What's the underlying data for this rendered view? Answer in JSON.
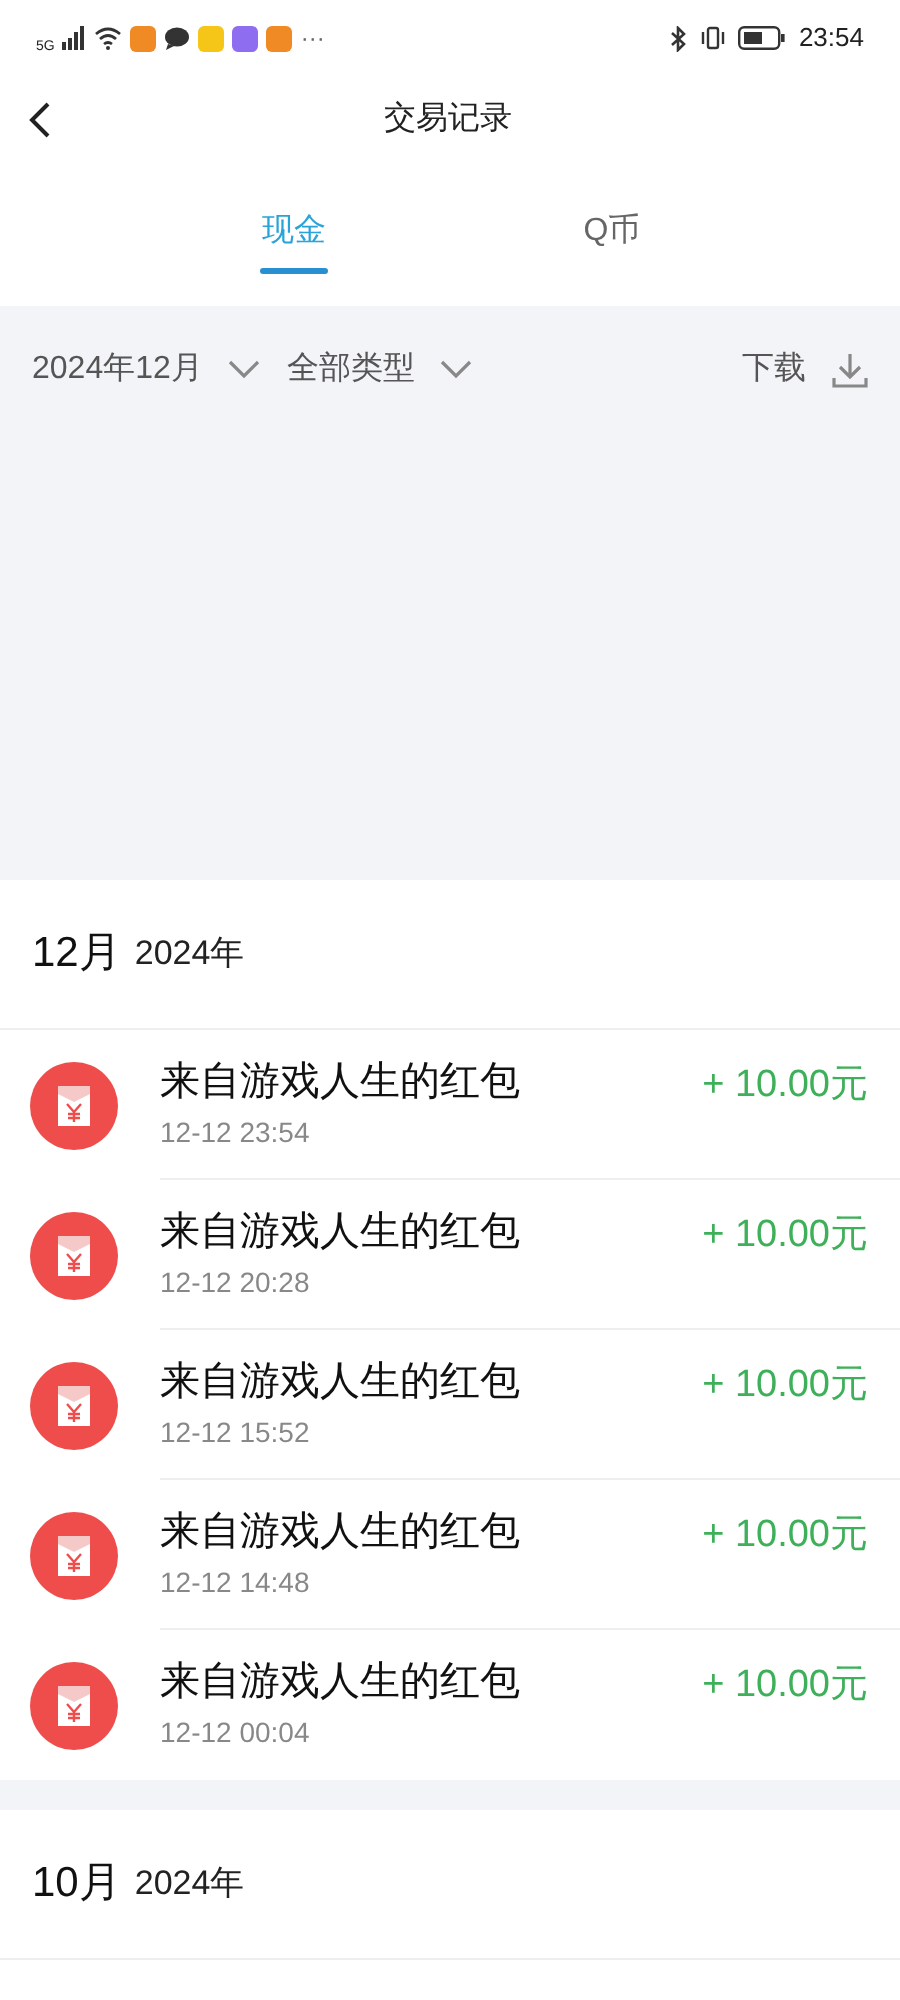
{
  "status_bar": {
    "network": "5G",
    "time": "23:54",
    "more": "···"
  },
  "header": {
    "title": "交易记录"
  },
  "tabs": [
    {
      "label": "现金",
      "selected": true
    },
    {
      "label": "Q币",
      "selected": false
    }
  ],
  "filters": {
    "month": "2024年12月",
    "type": "全部类型",
    "download": "下载"
  },
  "sections": [
    {
      "month": "12月",
      "year": "2024年",
      "rows": [
        {
          "title": "来自游戏人生的红包",
          "time": "12-12 23:54",
          "amount": "+ 10.00元"
        },
        {
          "title": "来自游戏人生的红包",
          "time": "12-12 20:28",
          "amount": "+ 10.00元"
        },
        {
          "title": "来自游戏人生的红包",
          "time": "12-12 15:52",
          "amount": "+ 10.00元"
        },
        {
          "title": "来自游戏人生的红包",
          "time": "12-12 14:48",
          "amount": "+ 10.00元"
        },
        {
          "title": "来自游戏人生的红包",
          "time": "12-12 00:04",
          "amount": "+ 10.00元"
        }
      ]
    },
    {
      "month": "10月",
      "year": "2024年"
    }
  ]
}
